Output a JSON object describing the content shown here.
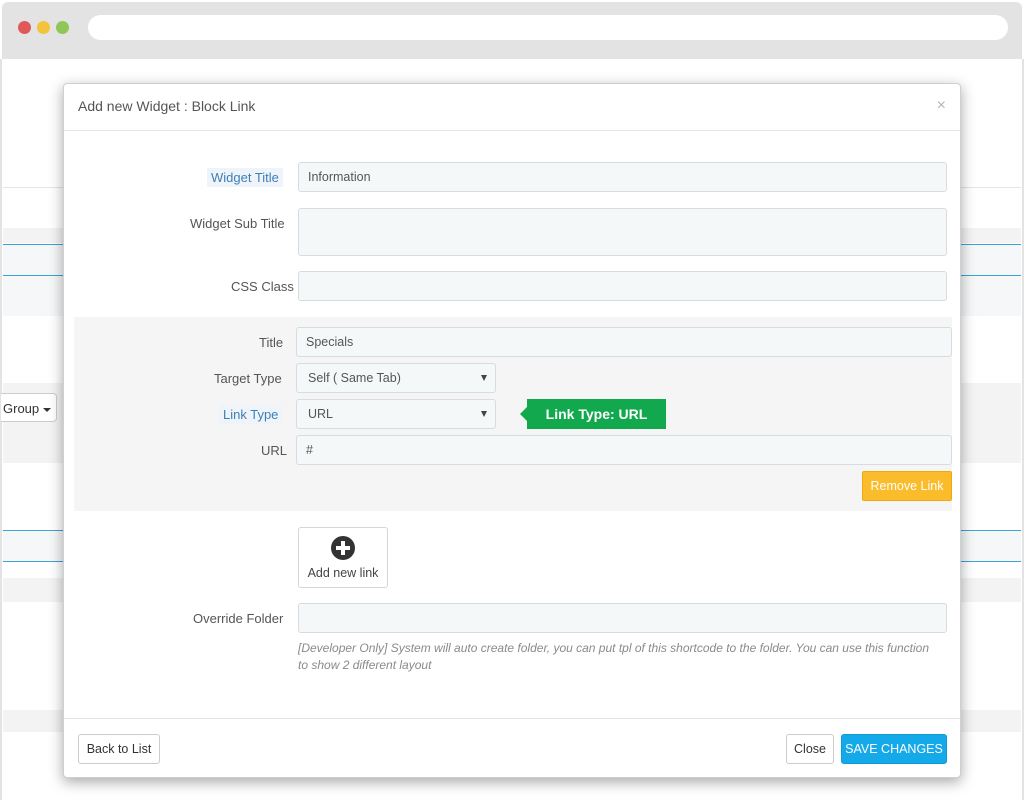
{
  "modal": {
    "title": "Add new Widget : Block Link",
    "close_glyph": "×"
  },
  "background": {
    "group_button_label": "Group"
  },
  "form": {
    "widget_title": {
      "label": "Widget Title",
      "value": "Information"
    },
    "widget_sub_title": {
      "label": "Widget Sub Title",
      "value": ""
    },
    "css_class": {
      "label": "CSS Class",
      "value": ""
    },
    "link": {
      "title": {
        "label": "Title",
        "value": "Specials"
      },
      "target_type": {
        "label": "Target Type",
        "selected": "Self ( Same Tab)"
      },
      "link_type": {
        "label": "Link Type",
        "selected": "URL"
      },
      "url": {
        "label": "URL",
        "value": "#"
      },
      "remove_label": "Remove Link"
    },
    "add_link_label": "Add new link",
    "override_folder": {
      "label": "Override Folder",
      "value": "",
      "help": "[Developer Only] System will auto create folder, you can put tpl of this shortcode to the folder. You can use this function to show 2 different layout"
    }
  },
  "tooltip": {
    "text": "Link Type: URL"
  },
  "footer": {
    "back_label": "Back to List",
    "close_label": "Close",
    "save_label": "SAVE CHANGES"
  },
  "colors": {
    "accent_primary": "#14a9e8",
    "warning": "#fbbc2b",
    "tooltip": "#12a84e"
  }
}
